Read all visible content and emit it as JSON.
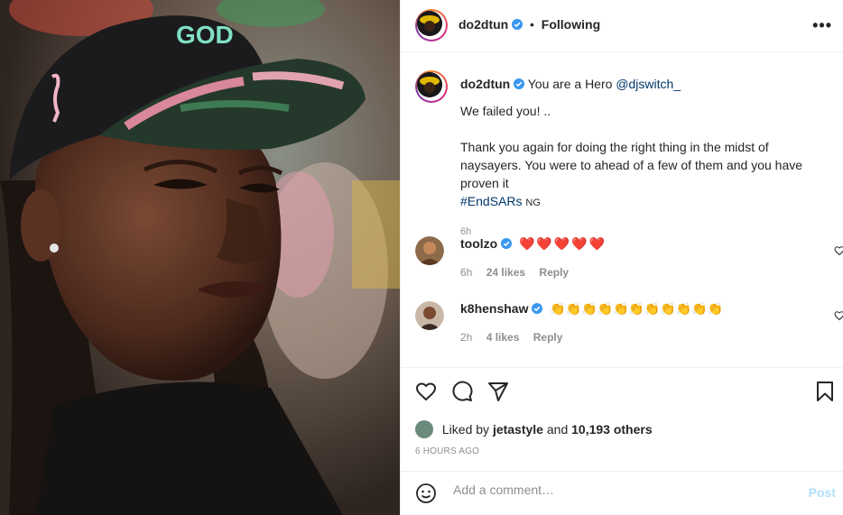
{
  "post": {
    "username": "do2dtun",
    "follow_status": "Following",
    "separator": "•"
  },
  "caption": {
    "username": "do2dtun",
    "line1": "You are a Hero",
    "mention": "@djswitch_",
    "line2": "We failed you! ..",
    "line3": "Thank you again for doing the right thing in the midst of naysayers. You were to ahead of a few of them and you have proven it",
    "hashtag": "#EndSARs",
    "hashtag_suffix": "NG",
    "time": "6h"
  },
  "comments": [
    {
      "username": "toolzo",
      "text": "❤️❤️❤️❤️❤️",
      "time": "6h",
      "likes": "24 likes",
      "reply": "Reply"
    },
    {
      "username": "k8henshaw",
      "text": "👏👏👏👏👏👏👏👏👏👏👏",
      "time": "2h",
      "likes": "4 likes",
      "reply": "Reply"
    }
  ],
  "likes": {
    "prefix": "Liked by",
    "user": "jetastyle",
    "and": "and",
    "count": "10,193 others"
  },
  "posted_ago": "6 HOURS AGO",
  "add_comment": {
    "placeholder": "Add a comment…",
    "post_label": "Post"
  },
  "icons": {
    "verified": "verified-badge-icon",
    "like": "heart-icon",
    "comment": "comment-icon",
    "share": "paper-plane-icon",
    "save": "bookmark-icon",
    "emoji": "smiley-icon",
    "more": "more-options-icon"
  },
  "colors": {
    "verified": "#3897f0",
    "link": "#00376b",
    "muted": "#8e8e8e",
    "post_disabled": "#b2dffc"
  }
}
